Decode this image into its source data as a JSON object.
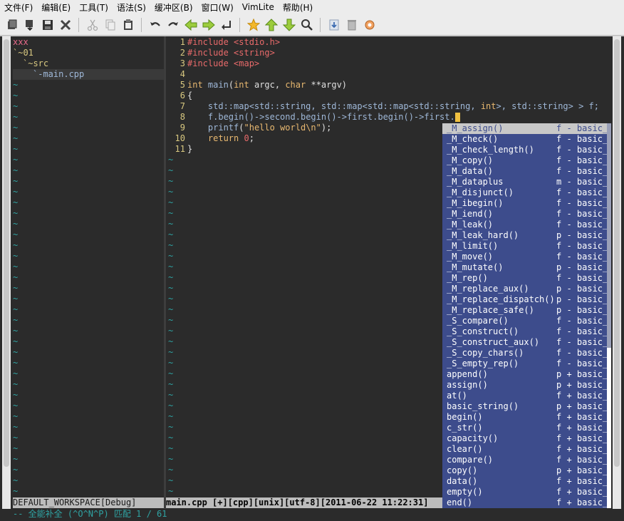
{
  "menu": [
    "文件(F)",
    "编辑(E)",
    "工具(T)",
    "语法(S)",
    "缓冲区(B)",
    "窗口(W)",
    "VimLite",
    "帮助(H)"
  ],
  "toolbar_icons": [
    "open-icon",
    "save-all-icon",
    "save-icon",
    "close-icon",
    "cut-icon",
    "copy-icon",
    "paste-icon",
    "undo-icon",
    "redo-icon",
    "back-arrow-icon",
    "forward-arrow-icon",
    "jump-icon",
    "star-icon",
    "up-arrow-icon",
    "down-arrow-icon",
    "find-icon",
    "download-icon",
    "trash-icon",
    "settings-icon"
  ],
  "tree": {
    "items": [
      "xxx",
      "`~01",
      "`~src",
      "`-main.cpp"
    ],
    "status": "DEFAULT_WORKSPACE[Debug]"
  },
  "code": {
    "line_numbers": [
      "1",
      "2",
      "3",
      "4",
      "5",
      "6",
      "7",
      "8",
      "9",
      "10",
      "11"
    ],
    "l1_kw": "#include",
    "l1_hdr": "<stdio.h>",
    "l2_kw": "#include",
    "l2_hdr": "<string>",
    "l3_kw": "#include",
    "l3_hdr": "<map>",
    "l5_int": "int",
    "l5_main": "main",
    "l5_paren": "(",
    "l5_int2": "int",
    "l5_argc": " argc, ",
    "l5_char": "char",
    "l5_argv": " **argv)",
    "l6": "{",
    "l7_a": "    std::map<std::string, std::map<std::map<std::string, ",
    "l7_int": "int",
    "l7_b": ">, std::string> > f;",
    "l8_a": "    f.",
    "l8_begin1": "begin",
    "l8_b": "()->second.",
    "l8_begin2": "begin",
    "l8_c": "()->first.",
    "l8_begin3": "begin",
    "l8_d": "()->first.",
    "l9_a": "    ",
    "l9_fn": "printf",
    "l9_b": "(",
    "l9_str": "\"hello world\\n\"",
    "l9_c": ");",
    "l10_a": "    ",
    "l10_kw": "return",
    "l10_b": " ",
    "l10_num": "0",
    "l10_c": ";",
    "l11": "}"
  },
  "status_main": "main.cpp [+][cpp][unix][utf-8][2011-06-22 11:22:31]",
  "cmdline": "-- 全能补全 (^O^N^P) 匹配 1 / 61",
  "completion": [
    {
      "name": "_M_assign()",
      "kind": "f - basic_"
    },
    {
      "name": "_M_check()",
      "kind": "f - basic_"
    },
    {
      "name": "_M_check_length()",
      "kind": "f - basic_"
    },
    {
      "name": "_M_copy()",
      "kind": "f - basic_"
    },
    {
      "name": "_M_data()",
      "kind": "f - basic_"
    },
    {
      "name": "_M_dataplus",
      "kind": "m - basic_"
    },
    {
      "name": "_M_disjunct()",
      "kind": "f - basic_"
    },
    {
      "name": "_M_ibegin()",
      "kind": "f - basic_"
    },
    {
      "name": "_M_iend()",
      "kind": "f - basic_"
    },
    {
      "name": "_M_leak()",
      "kind": "f - basic_"
    },
    {
      "name": "_M_leak_hard()",
      "kind": "p - basic_"
    },
    {
      "name": "_M_limit()",
      "kind": "f - basic_"
    },
    {
      "name": "_M_move()",
      "kind": "f - basic_"
    },
    {
      "name": "_M_mutate()",
      "kind": "p - basic_"
    },
    {
      "name": "_M_rep()",
      "kind": "f - basic_"
    },
    {
      "name": "_M_replace_aux()",
      "kind": "p - basic_"
    },
    {
      "name": "_M_replace_dispatch()",
      "kind": "p - basic_"
    },
    {
      "name": "_M_replace_safe()",
      "kind": "p - basic_"
    },
    {
      "name": "_S_compare()",
      "kind": "f - basic_"
    },
    {
      "name": "_S_construct()",
      "kind": "f - basic_"
    },
    {
      "name": "_S_construct_aux()",
      "kind": "f - basic_"
    },
    {
      "name": "_S_copy_chars()",
      "kind": "f - basic_"
    },
    {
      "name": "_S_empty_rep()",
      "kind": "f - basic_"
    },
    {
      "name": "append()",
      "kind": "p + basic_"
    },
    {
      "name": "assign()",
      "kind": "p + basic_"
    },
    {
      "name": "at()",
      "kind": "f + basic_"
    },
    {
      "name": "basic_string()",
      "kind": "p + basic_"
    },
    {
      "name": "begin()",
      "kind": "f + basic_"
    },
    {
      "name": "c_str()",
      "kind": "f + basic_"
    },
    {
      "name": "capacity()",
      "kind": "f + basic_"
    },
    {
      "name": "clear()",
      "kind": "f + basic_"
    },
    {
      "name": "compare()",
      "kind": "f + basic_"
    },
    {
      "name": "copy()",
      "kind": "p + basic_"
    },
    {
      "name": "data()",
      "kind": "f + basic_"
    },
    {
      "name": "empty()",
      "kind": "f + basic_"
    },
    {
      "name": "end()",
      "kind": "f + basic_"
    }
  ],
  "colors": {
    "popup": "#3d4c8c",
    "popup_selected": "#c8c8c8",
    "tilde": "#2fa3a3",
    "keyword": "#e8b870",
    "include": "#e86a6a"
  }
}
